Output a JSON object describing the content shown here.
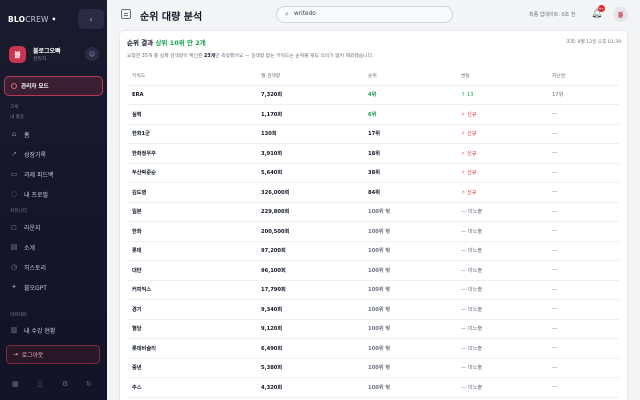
{
  "sidebar": {
    "logo_bold": "BLO",
    "logo_rest": "CREW",
    "logo_mark": "•",
    "profile": {
      "avatar_text": "블",
      "name": "블로그오빠",
      "role": "관리자"
    },
    "admin_mode_label": "관리자 모드",
    "section_top": "크루",
    "section_activity": "내 활동",
    "activity_items": [
      {
        "label": "홈",
        "icon": "home-icon"
      },
      {
        "label": "성장기록",
        "icon": "chart-icon"
      },
      {
        "label": "과제 피드백",
        "icon": "feedback-icon"
      },
      {
        "label": "내 프로필",
        "icon": "user-icon"
      }
    ],
    "section_community": "커뮤니티",
    "community_items": [
      {
        "label": "라운지",
        "icon": "lounge-icon"
      },
      {
        "label": "소개",
        "icon": "info-icon"
      },
      {
        "label": "히스토리",
        "icon": "history-icon"
      },
      {
        "label": "블오GPT",
        "icon": "gpt-icon"
      }
    ],
    "section_academy": "아카데미",
    "academy_items": [
      {
        "label": "내 수강 현황",
        "icon": "course-icon"
      }
    ],
    "logout_label": "로그아웃"
  },
  "topbar": {
    "title": "순위 대량 분석",
    "search_value": "writedo",
    "update_text": "최종 업데이트: 0초 전",
    "notification_count": "9+",
    "user_initial": "블"
  },
  "card": {
    "title_prefix": "순위 결과",
    "title_highlight": "상위 10위 안 2개",
    "timestamp": "조회: 8월 12일 오후 03:39",
    "desc_before": "요청한 35개 중 실제 검색량이 확인된 ",
    "desc_bold": "23개",
    "desc_after": "만 측정했어요 — 검색량 없는 키워드는 순위를 재도 의미가 없어 제외했습니다.",
    "columns": [
      "키워드",
      "월 검색량",
      "순위",
      "변동",
      "지난번"
    ],
    "rows": [
      {
        "keyword": "ERA",
        "volume": "7,320회",
        "rank": "4위",
        "rank_style": "top",
        "change": "↑ 13",
        "change_style": "up",
        "prev": "17위"
      },
      {
        "keyword": "실력",
        "volume": "1,170회",
        "rank": "6위",
        "rank_style": "top",
        "change": "✧ 신규",
        "change_style": "new",
        "prev": "—"
      },
      {
        "keyword": "한화1군",
        "volume": "130회",
        "rank": "17위",
        "rank_style": "mid",
        "change": "✧ 신규",
        "change_style": "new",
        "prev": "—"
      },
      {
        "keyword": "한화정우주",
        "volume": "3,910회",
        "rank": "18위",
        "rank_style": "mid",
        "change": "✧ 신규",
        "change_style": "new",
        "prev": "—"
      },
      {
        "keyword": "두산박준순",
        "volume": "5,640회",
        "rank": "38위",
        "rank_style": "mid",
        "change": "✧ 신규",
        "change_style": "new",
        "prev": "—"
      },
      {
        "keyword": "김도영",
        "volume": "326,000회",
        "rank": "84위",
        "rank_style": "mid",
        "change": "✧ 신규",
        "change_style": "new",
        "prev": "—"
      },
      {
        "keyword": "일본",
        "volume": "229,800회",
        "rank": "100위 밖",
        "rank_style": "out",
        "change": "— 미노출",
        "change_style": "none",
        "prev": "—"
      },
      {
        "keyword": "한화",
        "volume": "200,500회",
        "rank": "100위 밖",
        "rank_style": "out",
        "change": "— 미노출",
        "change_style": "none",
        "prev": "—"
      },
      {
        "keyword": "롯데",
        "volume": "97,200회",
        "rank": "100위 밖",
        "rank_style": "out",
        "change": "— 미노출",
        "change_style": "none",
        "prev": "—"
      },
      {
        "keyword": "대만",
        "volume": "96,100회",
        "rank": "100위 밖",
        "rank_style": "out",
        "change": "— 미노출",
        "change_style": "none",
        "prev": "—"
      },
      {
        "keyword": "커피믹스",
        "volume": "17,790회",
        "rank": "100위 밖",
        "rank_style": "out",
        "change": "— 미노출",
        "change_style": "none",
        "prev": "—"
      },
      {
        "keyword": "경기",
        "volume": "9,340회",
        "rank": "100위 밖",
        "rank_style": "out",
        "change": "— 미노출",
        "change_style": "none",
        "prev": "—"
      },
      {
        "keyword": "혈당",
        "volume": "9,120회",
        "rank": "100위 밖",
        "rank_style": "out",
        "change": "— 미노출",
        "change_style": "none",
        "prev": "—"
      },
      {
        "keyword": "롯데비슬리",
        "volume": "6,490회",
        "rank": "100위 밖",
        "rank_style": "out",
        "change": "— 미노출",
        "change_style": "none",
        "prev": "—"
      },
      {
        "keyword": "증년",
        "volume": "5,380회",
        "rank": "100위 밖",
        "rank_style": "out",
        "change": "— 미노출",
        "change_style": "none",
        "prev": "—"
      },
      {
        "keyword": "주스",
        "volume": "4,320회",
        "rank": "100위 밖",
        "rank_style": "out",
        "change": "— 미노출",
        "change_style": "none",
        "prev": "—"
      }
    ]
  }
}
